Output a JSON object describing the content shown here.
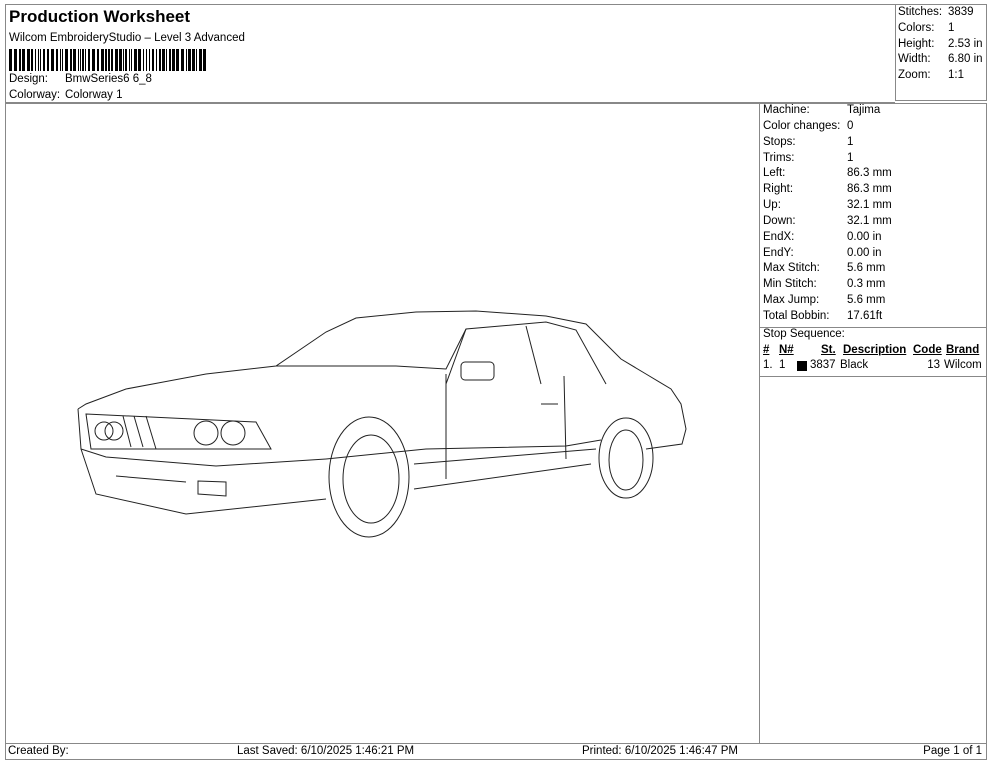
{
  "header": {
    "title": "Production Worksheet",
    "subtitle": "Wilcom EmbroideryStudio – Level 3 Advanced",
    "design_label": "Design:",
    "design_value": "BmwSeries6 6_8",
    "colorway_label": "Colorway:",
    "colorway_value": "Colorway 1"
  },
  "stats": [
    {
      "label": "Stitches:",
      "value": "3839"
    },
    {
      "label": "Colors:",
      "value": "1"
    },
    {
      "label": "Height:",
      "value": "2.53 in"
    },
    {
      "label": "Width:",
      "value": "6.80 in"
    },
    {
      "label": "Zoom:",
      "value": "1:1"
    }
  ],
  "details": [
    {
      "label": "Machine:",
      "value": "Tajima"
    },
    {
      "label": "Color changes:",
      "value": "0"
    },
    {
      "label": "Stops:",
      "value": "1"
    },
    {
      "label": "Trims:",
      "value": "1"
    },
    {
      "label": "Left:",
      "value": "86.3 mm"
    },
    {
      "label": "Right:",
      "value": "86.3 mm"
    },
    {
      "label": "Up:",
      "value": "32.1 mm"
    },
    {
      "label": "Down:",
      "value": "32.1 mm"
    },
    {
      "label": "EndX:",
      "value": "0.00 in"
    },
    {
      "label": "EndY:",
      "value": "0.00 in"
    },
    {
      "label": "Max Stitch:",
      "value": "5.6 mm"
    },
    {
      "label": "Min Stitch:",
      "value": "0.3 mm"
    },
    {
      "label": "Max Jump:",
      "value": "5.6 mm"
    },
    {
      "label": "Total Bobbin:",
      "value": "17.61ft"
    }
  ],
  "stop_sequence": {
    "label": "Stop Sequence:",
    "headers": [
      "#",
      "N#",
      "St.",
      "Description",
      "Code",
      "Brand"
    ],
    "rows": [
      {
        "num": "1.",
        "n": "1",
        "color": "#000000",
        "st": "3837",
        "description": "Black",
        "code": "13",
        "brand": "Wilcom"
      }
    ]
  },
  "footer": {
    "created_by": "Created By:",
    "last_saved": "Last Saved: 6/10/2025 1:46:21 PM",
    "printed": "Printed: 6/10/2025 1:46:47 PM",
    "page": "Page 1 of 1"
  }
}
